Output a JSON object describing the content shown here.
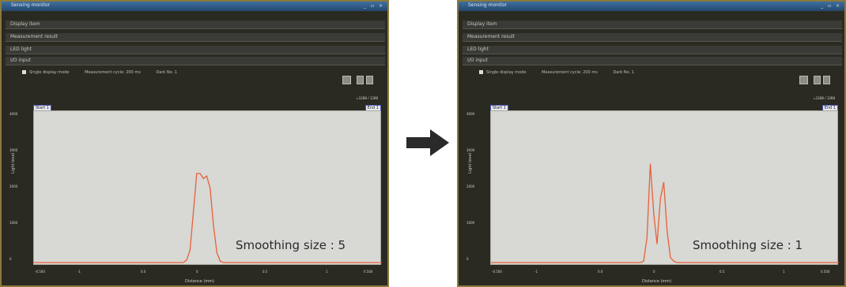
{
  "arrow": "right-arrow-icon",
  "panels": [
    {
      "title": "Sensing monitor",
      "window_controls": "_ ▫ ×",
      "sections": [
        "Display item",
        "Measurement result",
        "LED light",
        "I/O input"
      ],
      "options": {
        "single": "Single display mode",
        "cycle": "Measurement cycle: 200 ms",
        "dark": "Dark No. 1"
      },
      "readout": "=1288 / 1288",
      "start_tag": "Start 1",
      "end_tag": "End 1",
      "yticks": [
        "4000",
        "3000",
        "2000",
        "1000",
        "0"
      ],
      "ylabel": "Light level",
      "xticks": [
        "-1",
        "0.0",
        "0",
        "0.5",
        "1"
      ],
      "xlabel": "Distance (mm)",
      "x_edge_left": "-0.500",
      "x_edge_right": "0.500",
      "caption": "Smoothing size : 5",
      "peak_profile": [
        0,
        0,
        0,
        0,
        2,
        10,
        40,
        72,
        72,
        68,
        70,
        60,
        30,
        8,
        1,
        0,
        0
      ]
    },
    {
      "title": "Sensing monitor",
      "window_controls": "_ ▫ ×",
      "sections": [
        "Display item",
        "Measurement result",
        "LED light",
        "I/O input"
      ],
      "options": {
        "single": "Single display mode",
        "cycle": "Measurement cycle: 200 ms",
        "dark": "Dark No. 1"
      },
      "readout": "=1288 / 1288",
      "start_tag": "Start 1",
      "end_tag": "End 1",
      "yticks": [
        "4000",
        "3000",
        "2000",
        "1000",
        "0"
      ],
      "ylabel": "Light level",
      "xticks": [
        "-1",
        "0.0",
        "0",
        "0.5",
        "1"
      ],
      "xlabel": "Distance (mm)",
      "x_edge_left": "-0.500",
      "x_edge_right": "0.500",
      "caption": "Smoothing size : 1",
      "peak_profile": [
        0,
        0,
        0,
        0,
        1,
        20,
        80,
        40,
        15,
        52,
        65,
        25,
        4,
        1,
        0,
        0,
        0
      ]
    }
  ]
}
